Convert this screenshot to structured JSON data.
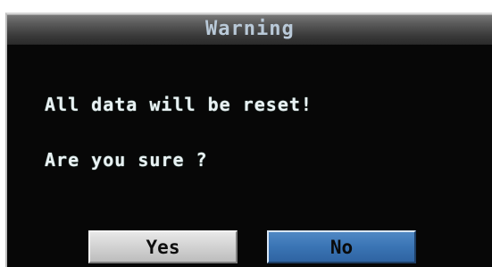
{
  "dialog": {
    "title": "Warning",
    "message": "All data will be reset!",
    "question": "Are you sure ?",
    "buttons": {
      "yes_label": "Yes",
      "no_label": "No"
    }
  },
  "colors": {
    "dialog_background": "#070707",
    "title_text": "#b9c9d8",
    "message_text": "#e9f1f3",
    "yes_button": "#d2d2d2",
    "no_button_selected": "#3a74b4"
  }
}
